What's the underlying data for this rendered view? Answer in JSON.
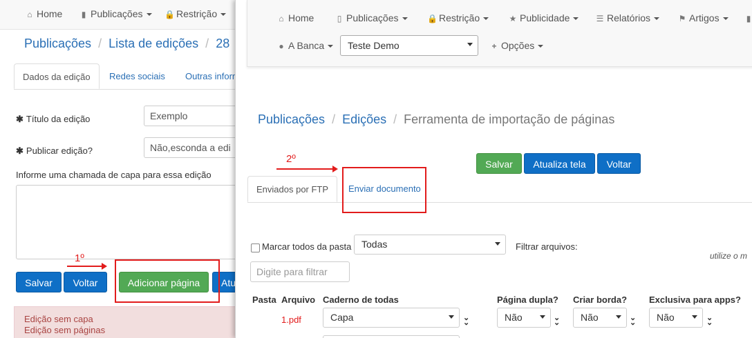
{
  "back": {
    "nav": {
      "home": "Home",
      "publicacoes": "Publicações",
      "restricao": "Restrição"
    },
    "breadcrumb": {
      "item1": "Publicações",
      "item2": "Lista de edições",
      "item3": "28"
    },
    "tabs": [
      "Dados da edição",
      "Redes sociais",
      "Outras inform"
    ],
    "form": {
      "titulo_label": "Título da edição",
      "titulo_value": "Exemplo",
      "publicar_label": "Publicar edição?",
      "publicar_value": "Não,esconda a edi",
      "chamada_label": "Informe uma chamada de capa para essa edição"
    },
    "buttons": {
      "salvar": "Salvar",
      "voltar": "Voltar",
      "adicionar": "Adicionar página",
      "atu": "Atu"
    },
    "alerts": [
      "Edição sem capa",
      "Edição sem páginas"
    ],
    "step1": "1º"
  },
  "front": {
    "nav": {
      "home": "Home",
      "publicacoes": "Publicações",
      "restricao": "Restrição",
      "publicidade": "Publicidade",
      "relatorios": "Relatórios",
      "artigos": "Artigos",
      "abanca": "A Banca",
      "site_select": "Teste Demo",
      "opcoes": "Opções"
    },
    "breadcrumb": {
      "item1": "Publicações",
      "item2": "Edições",
      "item3": "Ferramenta de importação de páginas"
    },
    "buttons": {
      "salvar": "Salvar",
      "atualiza": "Atualiza tela",
      "voltar": "Voltar"
    },
    "tabs": [
      "Enviados por FTP",
      "Enviar documento"
    ],
    "step2": "2º",
    "filters": {
      "marcar_todos": "Marcar todos da pasta",
      "pasta_select": "Todas",
      "filtrar_label": "Filtrar arquivos:",
      "filtrar_placeholder": "Digite para filtrar",
      "hint": "utilize o m"
    },
    "table": {
      "headers": {
        "pasta": "Pasta",
        "arquivo": "Arquivo",
        "caderno": "Caderno de todas",
        "pagina_dupla": "Página dupla?",
        "criar_borda": "Criar borda?",
        "exclusiva": "Exclusiva para apps?"
      },
      "row": {
        "arquivo": "1.pdf",
        "caderno": "Capa",
        "pagina_dupla": "Não",
        "criar_borda": "Não",
        "exclusiva": "Não"
      }
    }
  },
  "colors": {
    "accent_link": "#2a6fb5",
    "primary_button": "#0f6fc6",
    "success_button": "#52a955",
    "annotation_red": "#e21b1b",
    "alert_text": "#a94442"
  }
}
